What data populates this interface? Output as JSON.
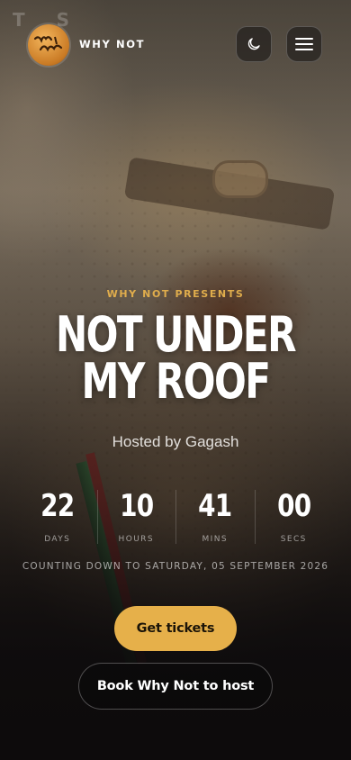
{
  "header": {
    "ghost_text": "T S",
    "brand_name": "WHY NOT",
    "logo_text": "Why Not"
  },
  "hero": {
    "kicker": "WHY NOT PRESENTS",
    "title": "NOT UNDER MY ROOF",
    "host": "Hosted by Gagash"
  },
  "countdown": {
    "units": [
      {
        "value": "22",
        "label": "DAYS"
      },
      {
        "value": "10",
        "label": "HOURS"
      },
      {
        "value": "41",
        "label": "MINS"
      },
      {
        "value": "00",
        "label": "SECS"
      }
    ],
    "note": "COUNTING DOWN TO SATURDAY, 05 SEPTEMBER 2026"
  },
  "actions": {
    "primary_label": "Get tickets",
    "secondary_label": "Book Why Not to host"
  },
  "icons": {
    "theme": "moon-icon",
    "menu": "hamburger-menu-icon"
  },
  "colors": {
    "accent": "#e6b04a",
    "kicker": "#e0ad4c",
    "background": "#0d0b0c"
  }
}
